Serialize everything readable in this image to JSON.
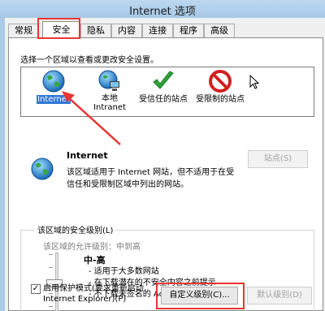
{
  "window": {
    "title": "Internet 选项"
  },
  "tabs": [
    "常规",
    "安全",
    "隐私",
    "内容",
    "连接",
    "程序",
    "高级"
  ],
  "active_tab": "安全",
  "instruction": "选择一个区域以查看或更改安全设置。",
  "zones": [
    {
      "label": "Internet",
      "icon": "globe-icon",
      "selected": true
    },
    {
      "label": "本地 Intranet",
      "icon": "intranet-icon",
      "selected": false
    },
    {
      "label": "受信任的站点",
      "icon": "checkmark-icon",
      "selected": false
    },
    {
      "label": "受限制的站点",
      "icon": "restricted-icon",
      "selected": false
    }
  ],
  "zone_detail": {
    "name": "Internet",
    "description": "该区域适用于 Internet 网站，但不适用于在受信任和受限制区域中列出的网站。",
    "sites_button": "站点(S)"
  },
  "security_level": {
    "group_title": "该区域的安全级别(L)",
    "allowed_levels": "该区域的允许级别：中到高",
    "level_name": "中-高",
    "bullets": [
      "- 适用于大多数网站",
      "- 在下载潜在的不安全内容之前提示",
      "- 不下载未签名的 ActiveX 控件"
    ]
  },
  "protected_mode": {
    "label": "启用保护模式(要求重新启动 Internet Explorer)(P)",
    "checked": true
  },
  "buttons": {
    "custom_level": "自定义级别(C)...",
    "default_level": "默认级别(D)"
  },
  "colors": {
    "annotation_red": "#e83535",
    "selection_blue": "#3178d6"
  }
}
